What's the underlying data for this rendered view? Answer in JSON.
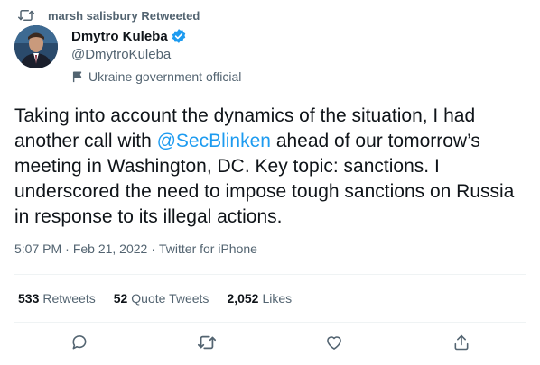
{
  "retweet": {
    "icon": "retweet-icon",
    "text": "marsh salisbury Retweeted"
  },
  "author": {
    "display_name": "Dmytro Kuleba",
    "handle": "@DmytroKuleba",
    "verified_icon": "verified-badge-icon",
    "label_icon": "flag-icon",
    "label": "Ukraine government official"
  },
  "tweet": {
    "text_before": "Taking into account the dynamics of the situation, I had another call with ",
    "mention": "@SecBlinken",
    "text_after": " ahead of our tomorrow’s meeting in Washington, DC. Key topic: sanctions. I underscored the need to impose tough sanctions on Russia in response to its illegal actions."
  },
  "meta": {
    "time": "5:07 PM",
    "separator": "·",
    "date": "Feb 21, 2022",
    "source": "Twitter for iPhone"
  },
  "stats": [
    {
      "count": "533",
      "label": "Retweets"
    },
    {
      "count": "52",
      "label": "Quote Tweets"
    },
    {
      "count": "2,052",
      "label": "Likes"
    }
  ],
  "actions": [
    {
      "icon": "reply-icon"
    },
    {
      "icon": "retweet-icon"
    },
    {
      "icon": "like-icon"
    },
    {
      "icon": "share-icon"
    }
  ],
  "colors": {
    "link": "#1d9bf0",
    "secondary_text": "#536471",
    "primary_text": "#0f1419",
    "divider": "#eff3f4"
  }
}
